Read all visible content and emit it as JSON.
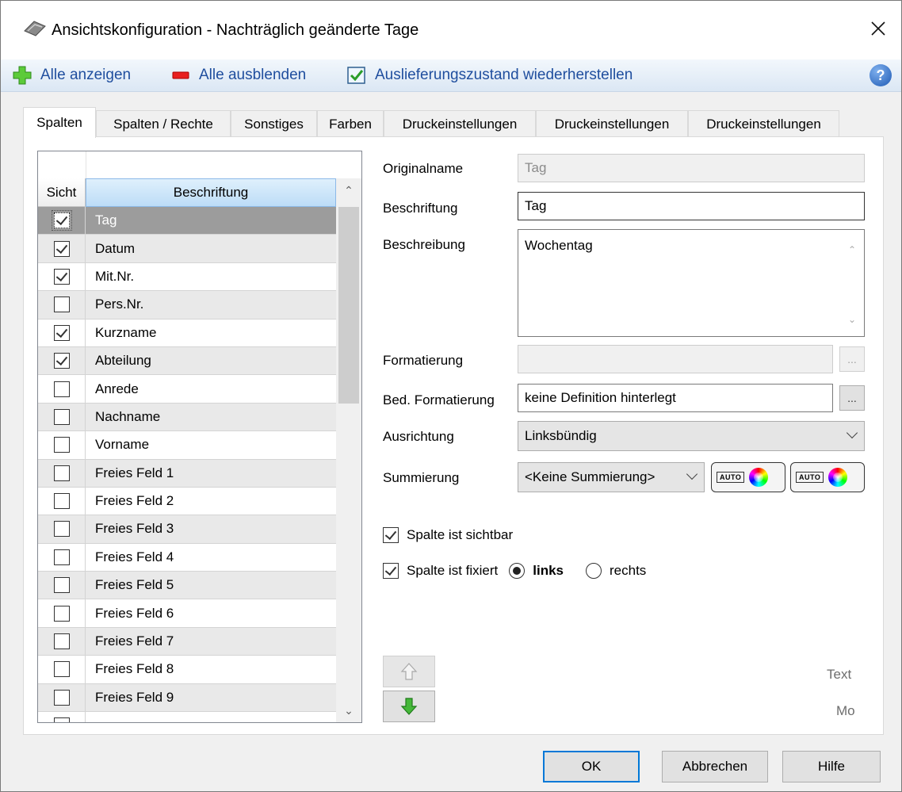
{
  "window": {
    "title": "Ansichtskonfiguration - Nachträglich geänderte Tage"
  },
  "toolbar": {
    "show_all": "Alle anzeigen",
    "hide_all": "Alle ausblenden",
    "restore": "Auslieferungszustand wiederherstellen"
  },
  "tabs": [
    {
      "label": "Spalten",
      "active": true
    },
    {
      "label": "Spalten / Rechte",
      "active": false
    },
    {
      "label": "Sonstiges",
      "active": false
    },
    {
      "label": "Farben",
      "active": false
    },
    {
      "label": "Druckeinstellungen",
      "active": false
    },
    {
      "label": "Druckeinstellungen",
      "active": false
    },
    {
      "label": "Druckeinstellungen",
      "active": false
    }
  ],
  "grid": {
    "col_visible": "Sicht",
    "col_label": "Beschriftung",
    "rows": [
      {
        "label": "Tag",
        "checked": true,
        "selected": true
      },
      {
        "label": "Datum",
        "checked": true
      },
      {
        "label": "Mit.Nr.",
        "checked": true
      },
      {
        "label": "Pers.Nr.",
        "checked": false
      },
      {
        "label": "Kurzname",
        "checked": true
      },
      {
        "label": "Abteilung",
        "checked": true
      },
      {
        "label": "Anrede",
        "checked": false
      },
      {
        "label": "Nachname",
        "checked": false
      },
      {
        "label": "Vorname",
        "checked": false
      },
      {
        "label": "Freies Feld 1",
        "checked": false
      },
      {
        "label": "Freies Feld 2",
        "checked": false
      },
      {
        "label": "Freies Feld 3",
        "checked": false
      },
      {
        "label": "Freies Feld 4",
        "checked": false
      },
      {
        "label": "Freies Feld 5",
        "checked": false
      },
      {
        "label": "Freies Feld 6",
        "checked": false
      },
      {
        "label": "Freies Feld 7",
        "checked": false
      },
      {
        "label": "Freies Feld 8",
        "checked": false
      },
      {
        "label": "Freies Feld 9",
        "checked": false
      },
      {
        "label": "",
        "checked": false
      }
    ]
  },
  "form": {
    "originalname_label": "Originalname",
    "originalname_value": "Tag",
    "beschriftung_label": "Beschriftung",
    "beschriftung_value": "Tag",
    "beschreibung_label": "Beschreibung",
    "beschreibung_value": "Wochentag",
    "formatierung_label": "Formatierung",
    "formatierung_value": "",
    "ellipsis": "...",
    "bed_formatierung_label": "Bed. Formatierung",
    "bed_formatierung_value": "keine Definition hinterlegt",
    "ausrichtung_label": "Ausrichtung",
    "ausrichtung_value": "Linksbündig",
    "summierung_label": "Summierung",
    "summierung_value": "<Keine Summierung>",
    "auto_label": "AUTO",
    "visible_label": "Spalte ist sichtbar",
    "fixed_label": "Spalte ist fixiert",
    "radio_left": "links",
    "radio_right": "rechts"
  },
  "preview": {
    "line1": "Text",
    "line2": "Mo"
  },
  "buttons": {
    "ok": "OK",
    "cancel": "Abbrechen",
    "help": "Hilfe"
  },
  "colors": {
    "link_blue": "#1f4e9e",
    "focus_blue": "#0078d7",
    "selected_row": "#9c9c9c",
    "header_blue": "#bcdcf7"
  }
}
